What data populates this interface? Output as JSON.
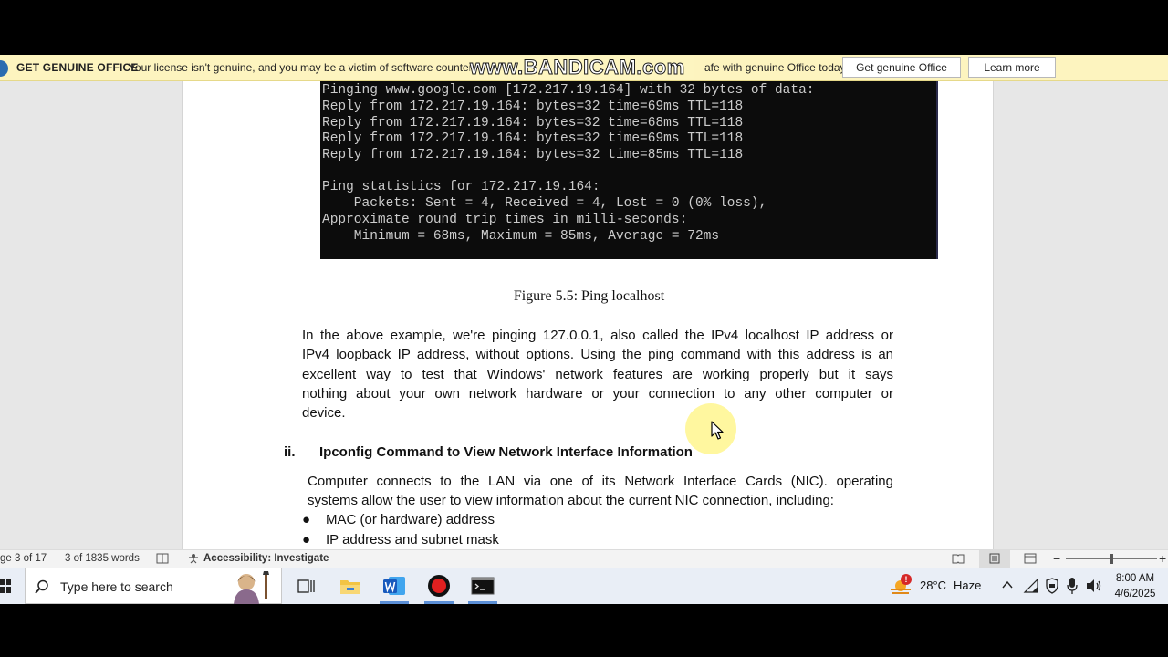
{
  "license_bar": {
    "title": "GET GENUINE OFFICE",
    "message_left": "Your license isn't genuine, and you may be a victim of software counterf",
    "message_right": "afe with genuine Office today.",
    "watermark": "www.BANDICAM.com",
    "get_genuine_button": "Get genuine Office",
    "learn_more_button": "Learn more"
  },
  "console": {
    "lines": [
      "Pinging www.google.com [172.217.19.164] with 32 bytes of data:",
      "Reply from 172.217.19.164: bytes=32 time=69ms TTL=118",
      "Reply from 172.217.19.164: bytes=32 time=68ms TTL=118",
      "Reply from 172.217.19.164: bytes=32 time=69ms TTL=118",
      "Reply from 172.217.19.164: bytes=32 time=85ms TTL=118",
      "",
      "Ping statistics for 172.217.19.164:",
      "    Packets: Sent = 4, Received = 4, Lost = 0 (0% loss),",
      "Approximate round trip times in milli-seconds:",
      "    Minimum = 68ms, Maximum = 85ms, Average = 72ms"
    ]
  },
  "document": {
    "figure_caption": "Figure 5.5: Ping localhost",
    "paragraph1": [
      "In the above example, we're pinging 127.0.0.1, also called the IPv4 localhost IP address or",
      "IPv4 loopback IP address, without options. Using the ping command with this address is an",
      "excellent way to test that Windows' network features are working properly but it says",
      "nothing about your own network hardware or your connection to any other computer or",
      "device."
    ],
    "heading_number": "ii.",
    "heading_text": "Ipconfig Command to View Network Interface Information",
    "paragraph2": [
      "Computer connects to the LAN via one of its Network Interface Cards (NIC). operating",
      "systems allow the user to view information about the current NIC connection, including:"
    ],
    "bullet_symbol": "●",
    "bullets": [
      "MAC (or hardware) address",
      "IP address and subnet mask"
    ]
  },
  "status_bar": {
    "page": "ge 3 of 17",
    "words": "3 of 1835 words",
    "accessibility": "Accessibility: Investigate",
    "zoom_minus": "−",
    "zoom_plus": "+",
    "zoom_level": 0.5
  },
  "taskbar": {
    "search_placeholder": "Type here to search",
    "weather_temp": "28°C",
    "weather_desc": "Haze",
    "weather_badge": "!",
    "time": "8:00 AM",
    "date": "4/6/2025"
  },
  "colors": {
    "license_bar_bg": "#fdf4bf",
    "console_bg": "#0c0c0c",
    "console_text": "#cccccc",
    "word_blue": "#185abd",
    "taskbar_bg": "#e9eef6"
  }
}
